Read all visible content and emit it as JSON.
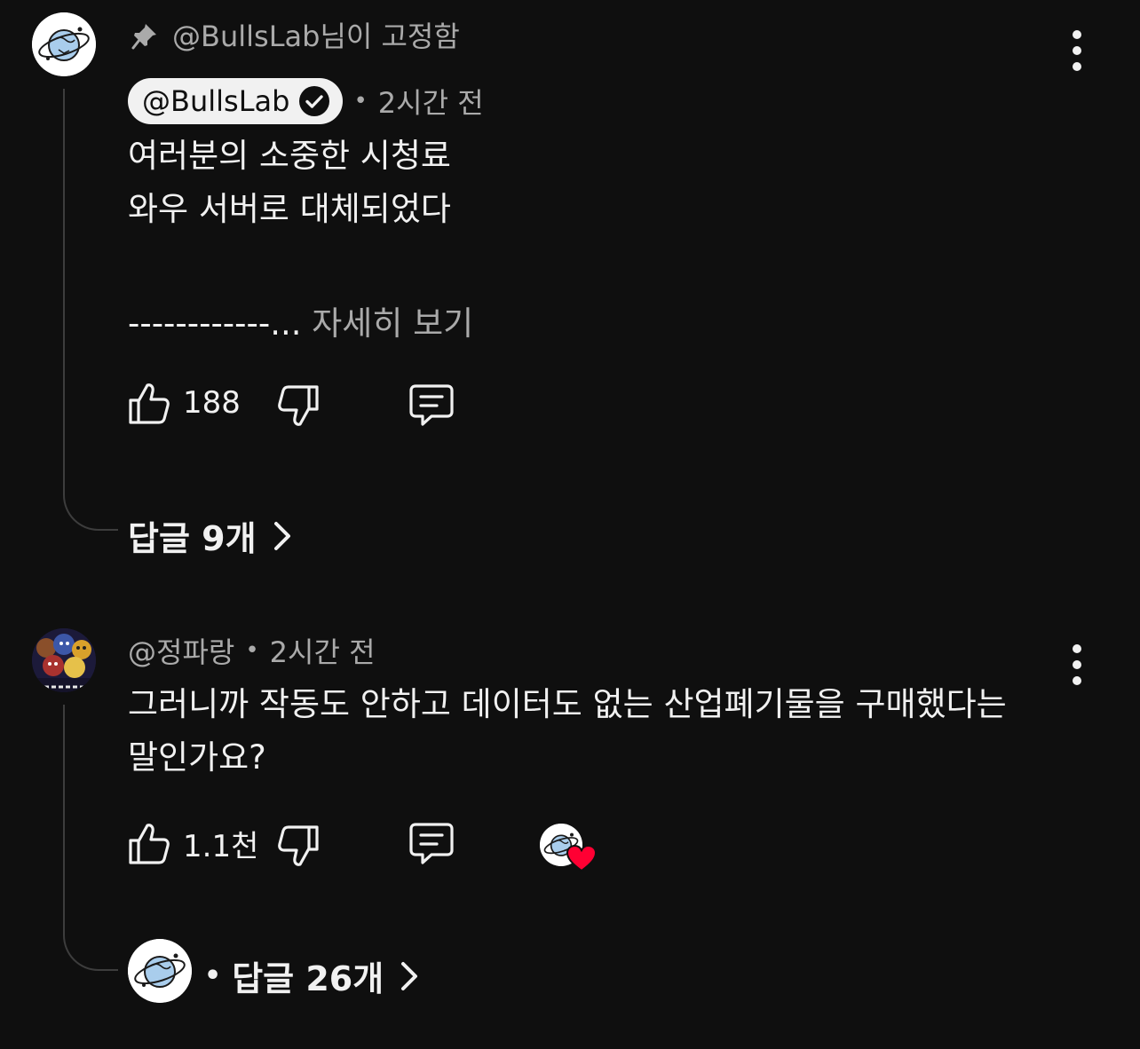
{
  "comments": [
    {
      "pinned_label": "@BullsLab님이 고정함",
      "author": "@BullsLab",
      "time": "2시간 전",
      "body_line1": "여러분의 소중한 시청료",
      "body_line2": "와우 서버로 대체되었다",
      "truncated_line": "------------...",
      "more_label": "자세히 보기",
      "likes": "188",
      "replies_label": "답글 9개",
      "avatar_icon": "globe-planet-icon"
    },
    {
      "author": "@정파랑",
      "time": "2시간 전",
      "body_line1": "그러니까 작동도 안하고 데이터도 없는 산업폐기물을 구매했다는",
      "body_line2": "말인가요?",
      "likes": "1.1천",
      "creator_heart": true,
      "replies_label": "답글 26개",
      "avatar_icon": "game-characters-avatar"
    }
  ],
  "colors": {
    "background": "#0f0f0f",
    "text": "#f1f1f1",
    "muted": "#aaaaaa",
    "heart": "#ff0033",
    "chip": "#f1f1f1"
  }
}
